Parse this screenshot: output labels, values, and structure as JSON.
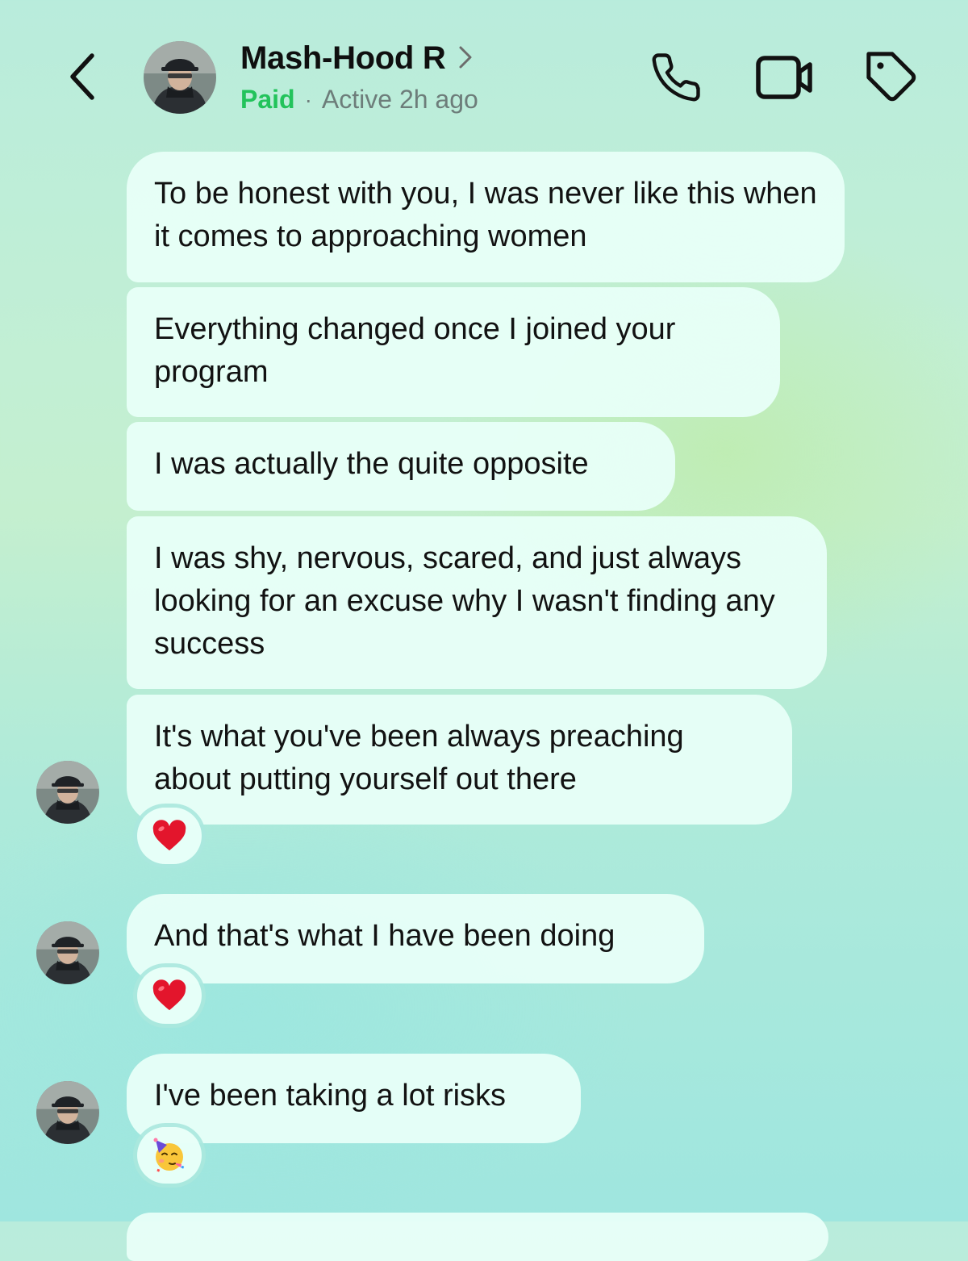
{
  "header": {
    "contact_name": "Mash-Hood R",
    "status_paid": "Paid",
    "status_separator": "·",
    "status_active": "Active 2h ago",
    "icons": [
      "chevron-left-icon",
      "avatar",
      "chevron-right-icon",
      "phone-icon",
      "video-camera-icon",
      "tag-icon"
    ]
  },
  "messages": [
    {
      "text": "To be honest with you, I was never like this when it comes to approaching women"
    },
    {
      "text": "Everything changed once I joined your program"
    },
    {
      "text": "I was actually the quite opposite"
    },
    {
      "text": "I was shy, nervous, scared, and just always looking for an excuse why I wasn't finding any success"
    },
    {
      "text": "It's what you've been always preaching about putting yourself out there",
      "reaction": "heart"
    },
    {
      "text": "And that's what I have been doing",
      "reaction": "heart"
    },
    {
      "text": "I've been taking a lot risks",
      "reaction": "partying-face"
    }
  ],
  "colors": {
    "paid_green": "#22c35b",
    "bubble": "#e8fff8",
    "heart_red": "#e3152c"
  }
}
